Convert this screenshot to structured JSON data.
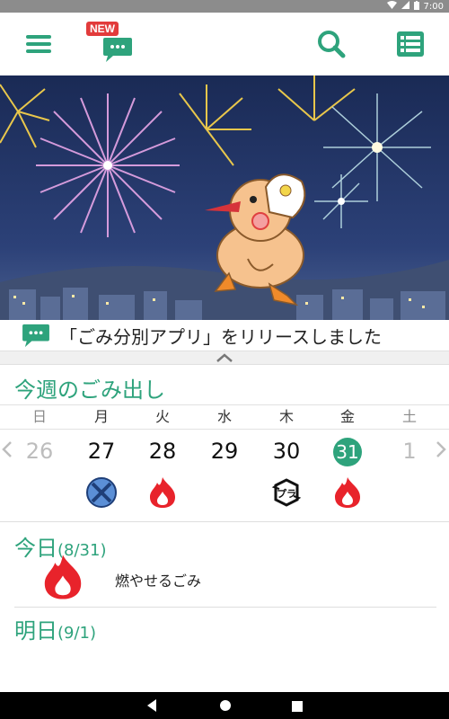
{
  "status": {
    "time": "7:00"
  },
  "toolbar": {
    "new_badge": "NEW",
    "accent_color": "#2ea37c"
  },
  "news": {
    "text": "「ごみ分別アプリ」をリリースしました"
  },
  "week": {
    "title": "今週のごみ出し",
    "days": [
      {
        "dow": "日",
        "date": "26",
        "state": "dim",
        "icon": ""
      },
      {
        "dow": "月",
        "date": "27",
        "state": "normal",
        "icon": "recycle-x-icon"
      },
      {
        "dow": "火",
        "date": "28",
        "state": "normal",
        "icon": "burnable-fire-icon"
      },
      {
        "dow": "水",
        "date": "29",
        "state": "normal",
        "icon": ""
      },
      {
        "dow": "木",
        "date": "30",
        "state": "normal",
        "icon": "plastic-recycle-icon"
      },
      {
        "dow": "金",
        "date": "31",
        "state": "today",
        "icon": "burnable-fire-icon"
      },
      {
        "dow": "土",
        "date": "1",
        "state": "dim",
        "icon": ""
      }
    ],
    "plastic_label": "プラ"
  },
  "today": {
    "label": "今日",
    "date": "(8/31)",
    "item": "燃やせるごみ"
  },
  "tomorrow": {
    "label": "明日",
    "date": "(9/1)"
  }
}
